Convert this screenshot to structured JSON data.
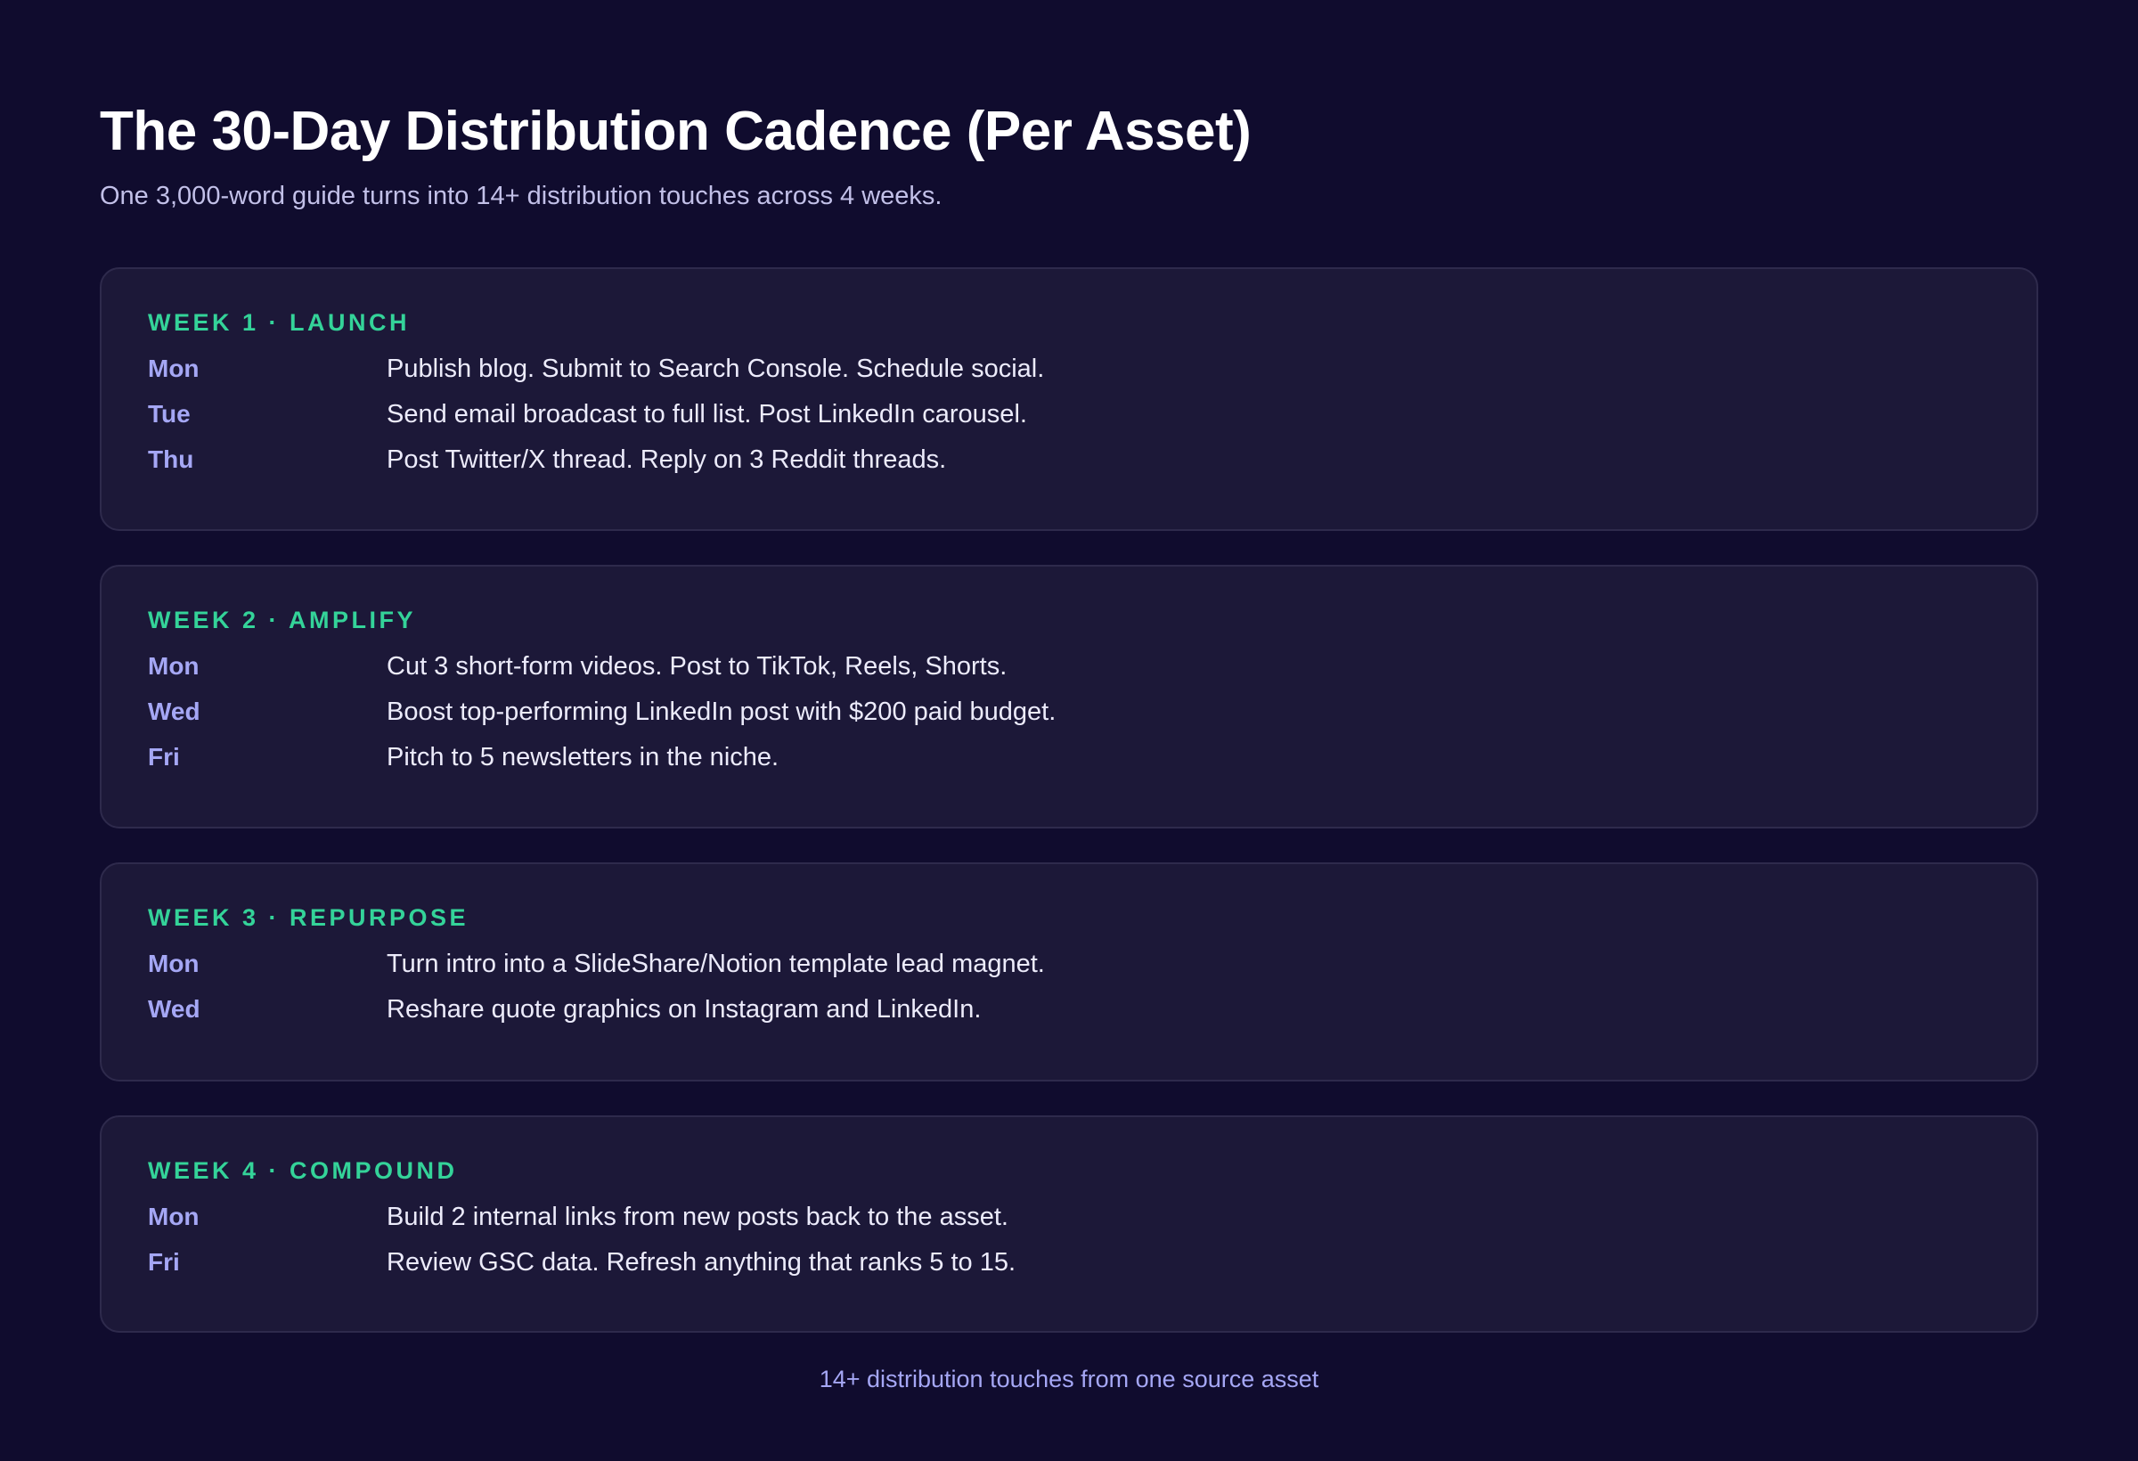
{
  "header": {
    "title": "The 30-Day Distribution Cadence (Per Asset)",
    "subtitle": "One 3,000-word guide turns into 14+ distribution touches across 4 weeks."
  },
  "weeks": [
    {
      "label": "WEEK 1 · LAUNCH",
      "rows": [
        {
          "day": "Mon",
          "task": "Publish blog. Submit to Search Console. Schedule social."
        },
        {
          "day": "Tue",
          "task": "Send email broadcast to full list. Post LinkedIn carousel."
        },
        {
          "day": "Thu",
          "task": "Post Twitter/X thread. Reply on 3 Reddit threads."
        }
      ]
    },
    {
      "label": "WEEK 2 · AMPLIFY",
      "rows": [
        {
          "day": "Mon",
          "task": "Cut 3 short-form videos. Post to TikTok, Reels, Shorts."
        },
        {
          "day": "Wed",
          "task": "Boost top-performing LinkedIn post with $200 paid budget."
        },
        {
          "day": "Fri",
          "task": "Pitch to 5 newsletters in the niche."
        }
      ]
    },
    {
      "label": "WEEK 3 · REPURPOSE",
      "rows": [
        {
          "day": "Mon",
          "task": "Turn intro into a SlideShare/Notion template lead magnet."
        },
        {
          "day": "Wed",
          "task": "Reshare quote graphics on Instagram and LinkedIn."
        }
      ]
    },
    {
      "label": "WEEK 4 · COMPOUND",
      "rows": [
        {
          "day": "Mon",
          "task": "Build 2 internal links from new posts back to the asset."
        },
        {
          "day": "Fri",
          "task": "Review GSC data. Refresh anything that ranks 5 to 15."
        }
      ]
    }
  ],
  "footer": {
    "text": "14+ distribution touches from one source asset"
  },
  "colors": {
    "background": "#100c2e",
    "card": "#1c1838",
    "accent_green": "#34d399",
    "accent_lavender": "#a5a7f5"
  }
}
